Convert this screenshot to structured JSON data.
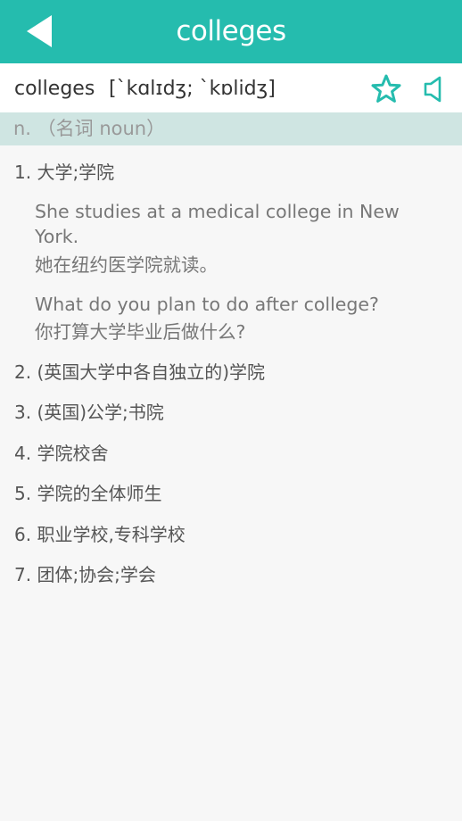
{
  "nav": {
    "title": "colleges",
    "back_icon": "back-arrow-icon",
    "bar_color": "#25bcae"
  },
  "entry": {
    "headword": "colleges",
    "phonetic": "[`kɑlɪdʒ; `kɒlidʒ]",
    "star_icon": "star-outline-icon",
    "sound_icon": "speaker-icon",
    "pos": "n. （名词 noun）"
  },
  "definitions": [
    {
      "text": "1. 大学;学院"
    },
    {
      "text": "2. (英国大学中各自独立的)学院"
    },
    {
      "text": "3. (英国)公学;书院"
    },
    {
      "text": "4. 学院校舍"
    },
    {
      "text": "5. 学院的全体师生"
    },
    {
      "text": "6. 职业学校,专科学校"
    },
    {
      "text": "7. 团体;协会;学会"
    }
  ],
  "examples": [
    {
      "en": "She studies at a medical college in New York.",
      "zh": "她在纽约医学院就读。"
    },
    {
      "en": "What do you plan to do after college?",
      "zh": "你打算大学毕业后做什么?"
    }
  ]
}
